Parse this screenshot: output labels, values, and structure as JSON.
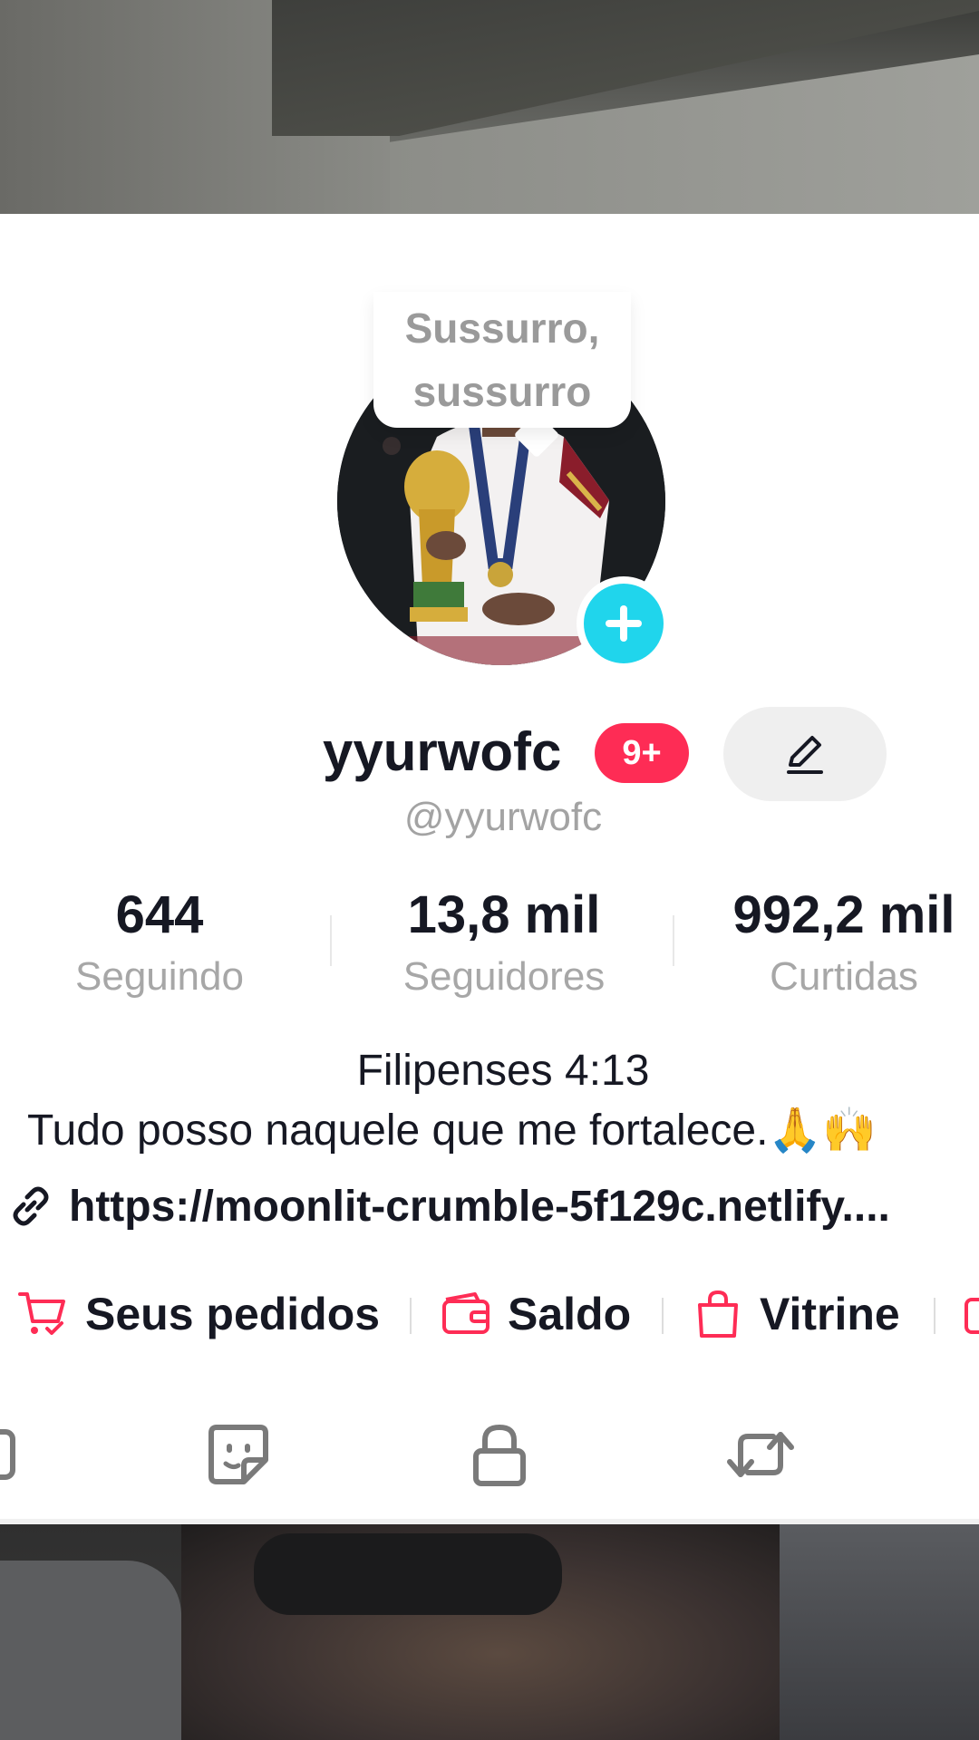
{
  "profile": {
    "bubble_line1": "Sussurro,",
    "bubble_line2": "sussurro",
    "username": "yyurwofc",
    "notification_badge": "9+",
    "handle": "@yyurwofc"
  },
  "stats": {
    "following_count": "644",
    "following_label": "Seguindo",
    "followers_count": "13,8 mil",
    "followers_label": "Seguidores",
    "likes_count": "992,2 mil",
    "likes_label": "Curtidas"
  },
  "bio": {
    "line1": "Filipenses 4:13",
    "line2": "Tudo posso naquele que me fortalece.🙏🙌"
  },
  "link": {
    "text": "https://moonlit-crumble-5f129c.netlify...."
  },
  "shop": {
    "orders_label": "Seus pedidos",
    "balance_label": "Saldo",
    "showcase_label": "Vitrine"
  },
  "colors": {
    "accent": "#fe2c55",
    "plus_button": "#20d5ec",
    "text_primary": "#161823",
    "text_secondary": "#a3a3a3"
  },
  "icons": {
    "edit": "pencil-icon",
    "link": "link-icon",
    "orders": "cart-icon",
    "balance": "wallet-icon",
    "showcase": "shopping-bag-icon",
    "tab_sticker": "sticker-icon",
    "tab_private": "lock-icon",
    "tab_reposts": "repost-icon"
  }
}
